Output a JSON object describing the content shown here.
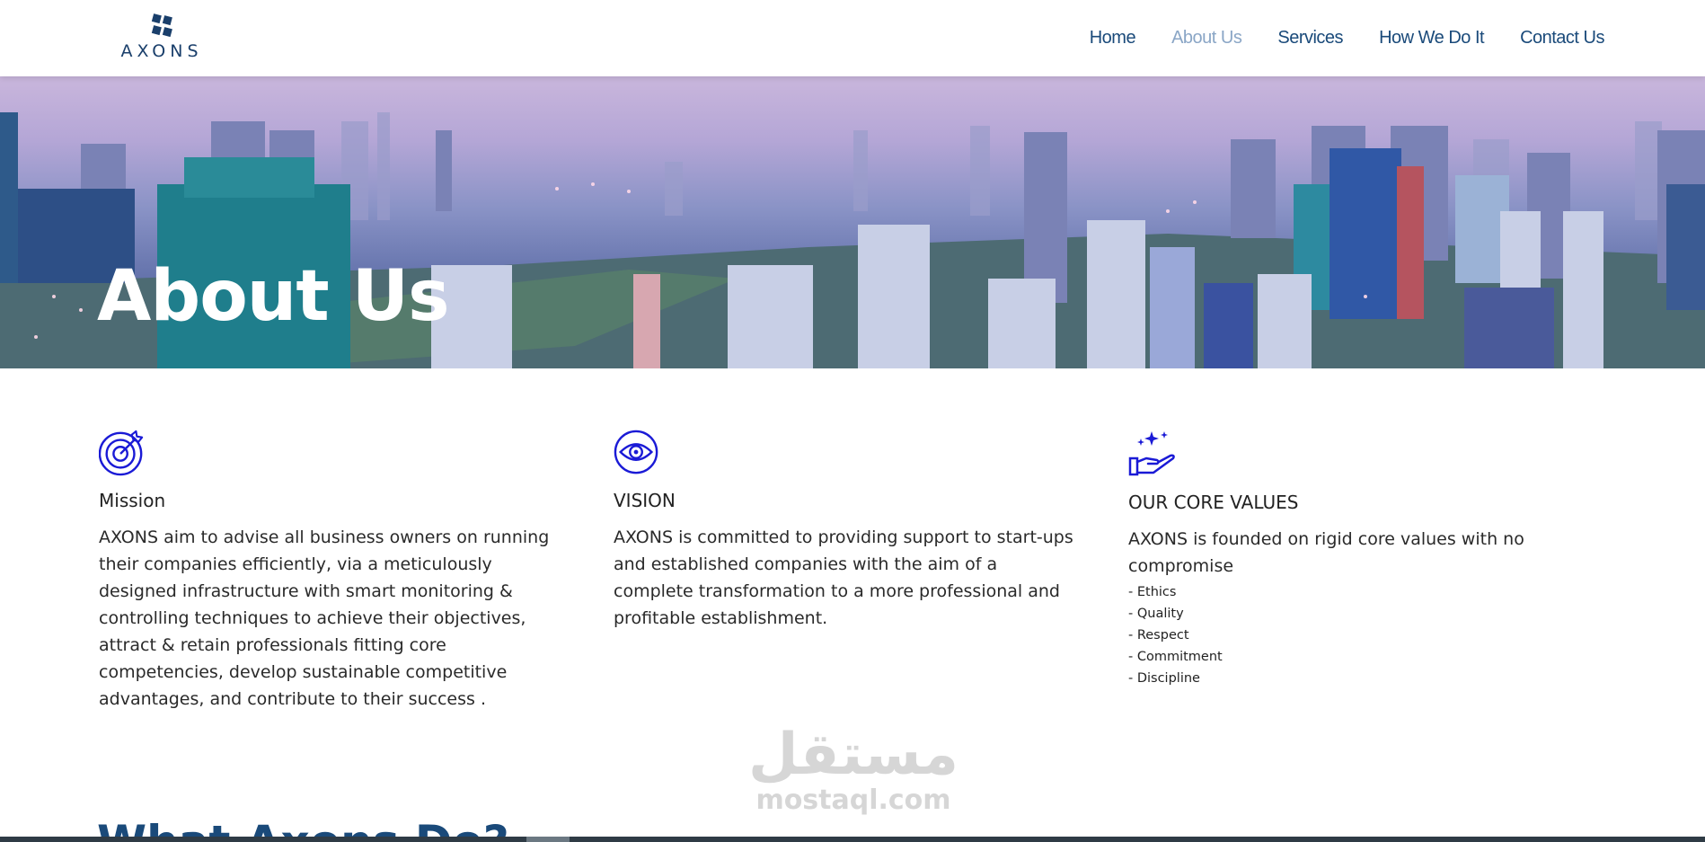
{
  "brand": {
    "name": "AXONS",
    "primary": "#1a4a7a",
    "accent_icon": "#1a1ad6"
  },
  "nav": {
    "items": [
      {
        "label": "Home",
        "active": false
      },
      {
        "label": "About Us",
        "active": true
      },
      {
        "label": "Services",
        "active": false
      },
      {
        "label": "How We Do It",
        "active": false
      },
      {
        "label": "Contact Us",
        "active": false
      }
    ]
  },
  "hero": {
    "title": "About Us"
  },
  "sections": {
    "mission": {
      "icon": "target-icon",
      "title": "Mission",
      "text": "AXONS aim to advise all business owners on running their companies efficiently, via a meticulously designed infrastructure with smart monitoring & controlling techniques to achieve their objectives, attract & retain professionals fitting core competencies, develop sustainable competitive advantages, and contribute to their success ."
    },
    "vision": {
      "icon": "eye-icon",
      "title": "VISION",
      "text": "AXONS is committed to providing support to start-ups and established companies with the aim of a complete transformation to a more professional and profitable establishment."
    },
    "values": {
      "icon": "hand-sparkle-icon",
      "title": "OUR CORE VALUES",
      "text": "AXONS is founded on rigid core values with no compromise",
      "items": [
        "- Ethics",
        "- Quality",
        "- Respect",
        "- Commitment",
        "- Discipline"
      ]
    }
  },
  "watermark": {
    "arabic": "مستقل",
    "latin": "mostaql.com"
  },
  "next_section": {
    "title": "What Axons Do?"
  }
}
